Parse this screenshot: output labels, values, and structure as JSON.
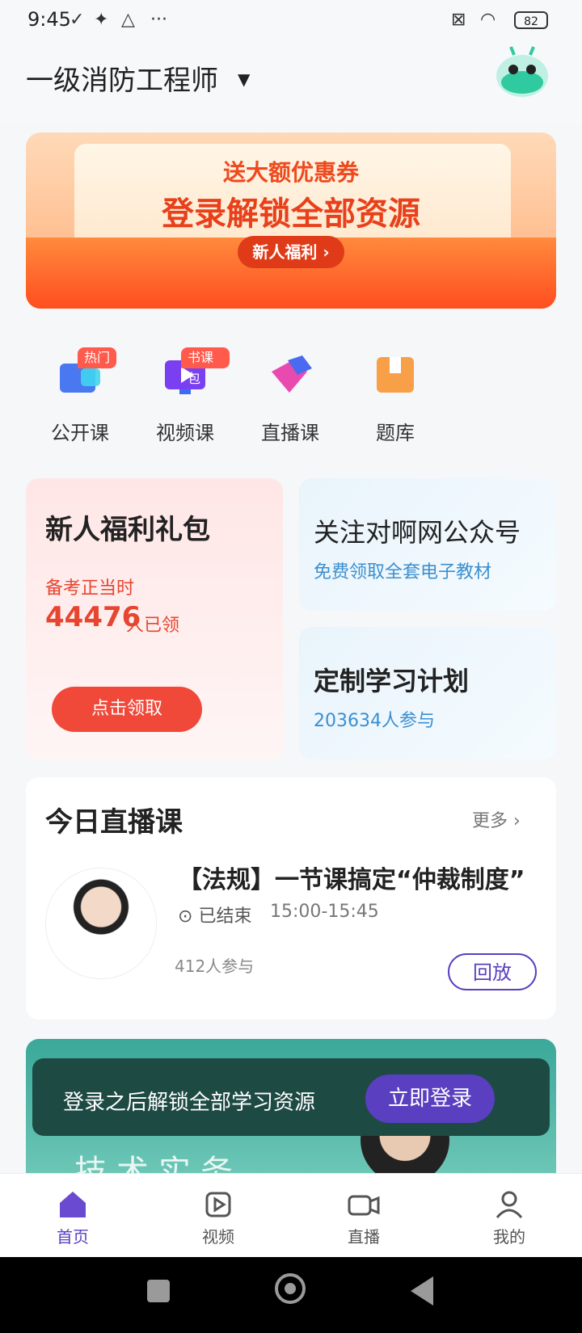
{
  "status_bar": {
    "time": "9:45",
    "icons": [
      "check-icon",
      "settings-icon",
      "drive-icon",
      "more-dots-icon"
    ],
    "right_icons": [
      "no-sim-icon",
      "wifi-icon"
    ],
    "battery": "82"
  },
  "header": {
    "title": "一级消防工程师",
    "dropdown_icon": "caret-down-icon",
    "mascot_icon": "robot-mascot-icon"
  },
  "banner": {
    "subtitle": "送大额优惠券",
    "title": "登录解锁全部资源",
    "button": "新人福利 ›"
  },
  "quick_nav": [
    {
      "label": "公开课",
      "badge": "热门",
      "icon": "open-class-icon"
    },
    {
      "label": "视频课",
      "badge": "书课包",
      "icon": "video-course-icon"
    },
    {
      "label": "直播课",
      "badge": "",
      "icon": "live-course-icon"
    },
    {
      "label": "题库",
      "badge": "",
      "icon": "question-bank-icon"
    }
  ],
  "gift_card": {
    "title": "新人福利礼包",
    "subtitle": "备考正当时",
    "count": "44476",
    "count_unit": "人已领",
    "button": "点击领取"
  },
  "follow_card": {
    "title": "关注对啊网公众号",
    "subtitle": "免费领取全套电子教材"
  },
  "plan_card": {
    "title": "定制学习计划",
    "subtitle": "203634人参与"
  },
  "live_section": {
    "title": "今日直播课",
    "more": "更多",
    "course": {
      "title": "【法规】一节课搞定“仲裁制度”",
      "status": "已结束",
      "time": "15:00-15:45",
      "participants": "412人参与",
      "button": "回放"
    }
  },
  "login_promo": {
    "text": "登录之后解锁全部学习资源",
    "button": "立即登录",
    "watermark": "技术实务"
  },
  "tab_bar": [
    {
      "label": "首页",
      "icon": "home-icon",
      "active": true
    },
    {
      "label": "视频",
      "icon": "video-icon",
      "active": false
    },
    {
      "label": "直播",
      "icon": "camera-icon",
      "active": false
    },
    {
      "label": "我的",
      "icon": "user-icon",
      "active": false
    }
  ],
  "colors": {
    "accent": "#5a3fc0",
    "red": "#f0493a",
    "blue_text": "#3b8fd0"
  }
}
